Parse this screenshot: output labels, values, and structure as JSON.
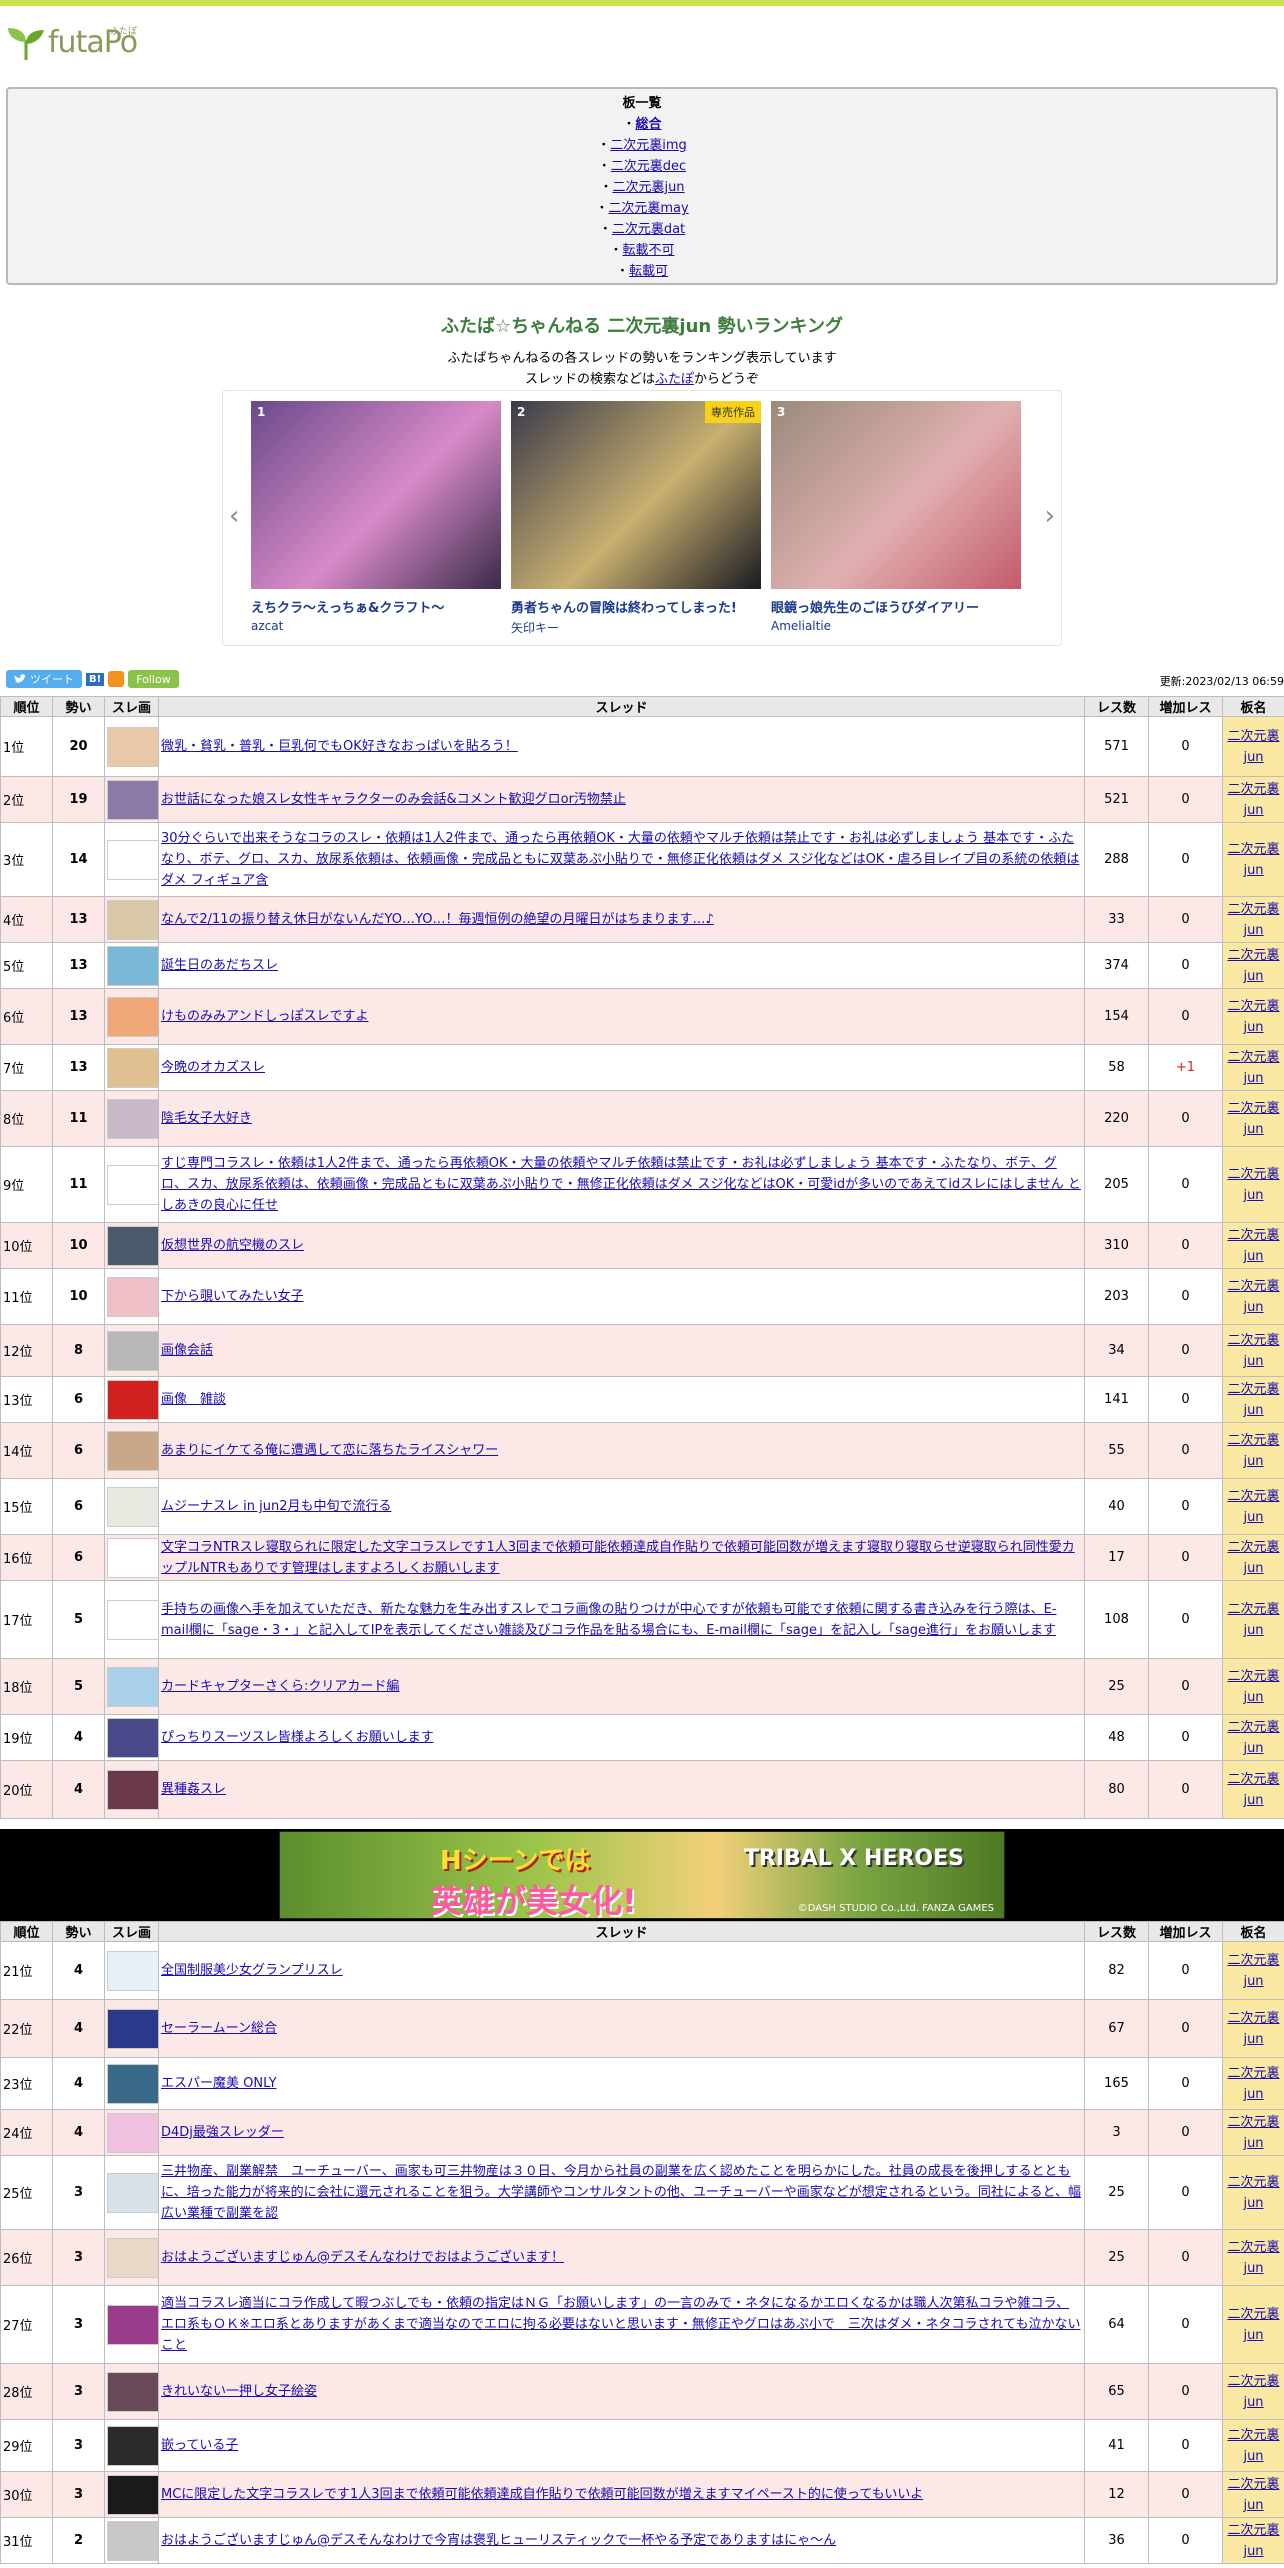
{
  "header": {
    "logo_text": "futaPo",
    "logo_small": "ふたぽ"
  },
  "boards": {
    "title": "板一覧",
    "items": [
      {
        "label": "総合",
        "active": true
      },
      {
        "label": "二次元裏img"
      },
      {
        "label": "二次元裏dec"
      },
      {
        "label": "二次元裏jun"
      },
      {
        "label": "二次元裏may"
      },
      {
        "label": "二次元裏dat"
      },
      {
        "label": "転載不可"
      },
      {
        "label": "転載可"
      }
    ]
  },
  "headline": {
    "title": "ふたば☆ちゃんねる 二次元裏jun 勢いランキング",
    "line1": "ふたばちゃんねるの各スレッドの勢いをランキング表示しています",
    "line2_pre": "スレッドの検索などは",
    "line2_link": "ふたぽ",
    "line2_post": "からどうぞ"
  },
  "carousel": {
    "prev": "‹",
    "next": "›",
    "items": [
      {
        "num": "1",
        "title": "えちクラ～えっちぁ&クラフト～",
        "circle": "azcat",
        "colors": [
          "#6a4a8a",
          "#d88ac8",
          "#3a2a4a"
        ]
      },
      {
        "num": "2",
        "title": "勇者ちゃんの冒険は終わってしまった!",
        "circle": "矢印キー",
        "badge": "専売作品",
        "colors": [
          "#3a3a4a",
          "#c8b070",
          "#1a1a22"
        ]
      },
      {
        "num": "3",
        "title": "眼鏡っ娘先生のごほうびダイアリー",
        "circle": "Amelialtie",
        "colors": [
          "#9a8a7a",
          "#e0b0b0",
          "#c45a6a"
        ]
      }
    ]
  },
  "social": {
    "tweet": "ツイート",
    "hatena": "B!",
    "follow": "Follow"
  },
  "updated": "更新:2023/02/13 06:59",
  "table": {
    "headers": [
      "順位",
      "勢い",
      "スレ画",
      "スレッド",
      "レス数",
      "増加レス",
      "板名"
    ],
    "board_name": "二次元裏jun",
    "rows_a": [
      {
        "rank": "1位",
        "speed": "20",
        "title": "微乳・貧乳・普乳・巨乳何でもOK好きなおっぱいを貼ろう！",
        "res": "571",
        "inc": "0",
        "thumb": "#e8c8a8"
      },
      {
        "rank": "2位",
        "speed": "19",
        "title": "お世話になった娘スレ女性キャラクターのみ会話&コメント歓迎グロor汚物禁止",
        "res": "521",
        "inc": "0",
        "thumb": "#8a7aa8"
      },
      {
        "rank": "3位",
        "speed": "14",
        "title": "30分ぐらいで出来そうなコラのスレ・依頼は1人2件まで、通ったら再依頼OK・大量の依頼やマルチ依頼は禁止です・お礼は必ずしましょう 基本です・ふたなり、ボテ、グロ、スカ、放尿系依頼は、依頼画像・完成品ともに双葉あぷ小貼りで・無修正化依頼はダメ スジ化などはOK・虐ろ目レイプ目の系統の依頼はダメ フィギュア含",
        "res": "288",
        "inc": "0",
        "thumb": "#ffffff"
      },
      {
        "rank": "4位",
        "speed": "13",
        "title": "なんで2/11の振り替え休日がないんだYO…YO…！毎週恒例の絶望の月曜日がはちまります…♪",
        "res": "33",
        "inc": "0",
        "thumb": "#d8c8a8"
      },
      {
        "rank": "5位",
        "speed": "13",
        "title": "誕生日のあだちスレ",
        "res": "374",
        "inc": "0",
        "thumb": "#7ab8d8"
      },
      {
        "rank": "6位",
        "speed": "13",
        "title": "けものみみアンドしっぽスレですよ",
        "res": "154",
        "inc": "0",
        "thumb": "#f0a878"
      },
      {
        "rank": "7位",
        "speed": "13",
        "title": "今晩のオカズスレ",
        "res": "58",
        "inc": "+1",
        "thumb": "#e0c090"
      },
      {
        "rank": "8位",
        "speed": "11",
        "title": "陰毛女子大好き",
        "res": "220",
        "inc": "0",
        "thumb": "#c8b8c8"
      },
      {
        "rank": "9位",
        "speed": "11",
        "title": "すじ専門コラスレ・依頼は1人2件まで、通ったら再依頼OK・大量の依頼やマルチ依頼は禁止です・お礼は必ずしましょう 基本です・ふたなり、ボテ、グロ、スカ、放尿系依頼は、依頼画像・完成品ともに双葉あぷ小貼りで・無修正化依頼はダメ スジ化などはOK・可愛idが多いのであえてidスレにはしません としあきの良心に任せ",
        "res": "205",
        "inc": "0",
        "thumb": "#ffffff"
      },
      {
        "rank": "10位",
        "speed": "10",
        "title": "仮想世界の航空機のスレ",
        "res": "310",
        "inc": "0",
        "thumb": "#4a5a6a"
      },
      {
        "rank": "11位",
        "speed": "10",
        "title": "下から覗いてみたい女子",
        "res": "203",
        "inc": "0",
        "thumb": "#f0c0c8"
      },
      {
        "rank": "12位",
        "speed": "8",
        "title": "画像会話",
        "res": "34",
        "inc": "0",
        "thumb": "#b8b8b8"
      },
      {
        "rank": "13位",
        "speed": "6",
        "title": "画像　雑談",
        "res": "141",
        "inc": "0",
        "thumb": "#d02020"
      },
      {
        "rank": "14位",
        "speed": "6",
        "title": "あまりにイケてる俺に遭遇して恋に落ちたライスシャワー",
        "res": "55",
        "inc": "0",
        "thumb": "#c8a888"
      },
      {
        "rank": "15位",
        "speed": "6",
        "title": "ムジーナスレ in jun2月も中旬で流行る",
        "res": "40",
        "inc": "0",
        "thumb": "#e8e8e0"
      },
      {
        "rank": "16位",
        "speed": "6",
        "title": "文字コラNTRスレ寝取られに限定した文字コラスレです1人3回まで依頼可能依頼達成自作貼りで依頼可能回数が増えます寝取り寝取らせ逆寝取られ同性愛カップルNTRもありです管理はしますよろしくお願いします",
        "res": "17",
        "inc": "0",
        "thumb": "#ffffff"
      },
      {
        "rank": "17位",
        "speed": "5",
        "title": "手持ちの画像へ手を加えていただき、新たな魅力を生み出すスレでコラ画像の貼りつけが中心ですが依頼も可能です依頼に関する書き込みを行う際は、E-mail欄に「sage・3・」と記入してIPを表示してください雑談及びコラ作品を貼る場合にも、E-mail欄に「sage」を記入し「sage進行」をお願いします",
        "res": "108",
        "inc": "0",
        "thumb": "#ffffff"
      },
      {
        "rank": "18位",
        "speed": "5",
        "title": "カードキャプターさくら:クリアカード編",
        "res": "25",
        "inc": "0",
        "thumb": "#a8d0e8"
      },
      {
        "rank": "19位",
        "speed": "4",
        "title": "ぴっちりスーツスレ皆様よろしくお願いします",
        "res": "48",
        "inc": "0",
        "thumb": "#4a4a8a"
      },
      {
        "rank": "20位",
        "speed": "4",
        "title": "異種姦スレ",
        "res": "80",
        "inc": "0",
        "thumb": "#6a3a4a"
      }
    ],
    "rows_b": [
      {
        "rank": "21位",
        "speed": "4",
        "title": "全国制服美少女グランプリスレ",
        "res": "82",
        "inc": "0",
        "thumb": "#e8f0f8"
      },
      {
        "rank": "22位",
        "speed": "4",
        "title": "セーラームーン総合",
        "res": "67",
        "inc": "0",
        "thumb": "#2a3a8a"
      },
      {
        "rank": "23位",
        "speed": "4",
        "title": "エスパー魔美 ONLY",
        "res": "165",
        "inc": "0",
        "thumb": "#3a6a8a"
      },
      {
        "rank": "24位",
        "speed": "4",
        "title": "D4Dj最強スレッダー",
        "res": "3",
        "inc": "0",
        "thumb": "#f0c0e0"
      },
      {
        "rank": "25位",
        "speed": "3",
        "title": "三井物産、副業解禁　ユーチューバー、画家も可三井物産は３０日、今月から社員の副業を広く認めたことを明らかにした。社員の成長を後押しするとともに、培った能力が将来的に会社に還元されることを狙う。大学講師やコンサルタントの他、ユーチューバーや画家などが想定されるという。同社によると、幅広い業種で副業を認",
        "res": "25",
        "inc": "0",
        "thumb": "#d8e0e8"
      },
      {
        "rank": "26位",
        "speed": "3",
        "title": "おはようございますじゅん@デスそんなわけでおはようございます！",
        "res": "25",
        "inc": "0",
        "thumb": "#e8d8c8"
      },
      {
        "rank": "27位",
        "speed": "3",
        "title": "適当コラスレ適当にコラ作成して暇つぶしでも・依頼の指定はＮＧ「お願いします」の一言のみで・ネタになるかエロくなるかは職人次第私コラや雑コラ、エロ系もＯＫ※エロ系とありますがあくまで適当なのでエロに拘る必要はないと思います・無修正やグロはあぷ小で　三次はダメ・ネタコラされても泣かないこと",
        "res": "64",
        "inc": "0",
        "thumb": "#9a3a8a"
      },
      {
        "rank": "28位",
        "speed": "3",
        "title": "きれいない一押し女子絵姿",
        "res": "65",
        "inc": "0",
        "thumb": "#6a4a5a"
      },
      {
        "rank": "29位",
        "speed": "3",
        "title": "嵌っている子",
        "res": "41",
        "inc": "0",
        "thumb": "#2a2a2a"
      },
      {
        "rank": "30位",
        "speed": "3",
        "title": "MCに限定した文字コラスレです1人3回まで依頼可能依頼達成自作貼りで依頼可能回数が増えますマイペースト的に使ってもいいよ",
        "res": "12",
        "inc": "0",
        "thumb": "#1a1a1a"
      },
      {
        "rank": "31位",
        "speed": "2",
        "title": "おはようございますじゅん@デスそんなわけで今宵は褒乳ヒューリスティックで一杯やる予定でありますはにゃ～ん",
        "res": "36",
        "inc": "0",
        "thumb": "#c8c8c8"
      }
    ]
  },
  "banner": {
    "line1": "Hシーンでは",
    "line2": "英雄が美女化!",
    "logo": "TRIBAL X HEROES",
    "copy": "©DASH STUDIO Co.,Ltd.  FANZA GAMES"
  }
}
